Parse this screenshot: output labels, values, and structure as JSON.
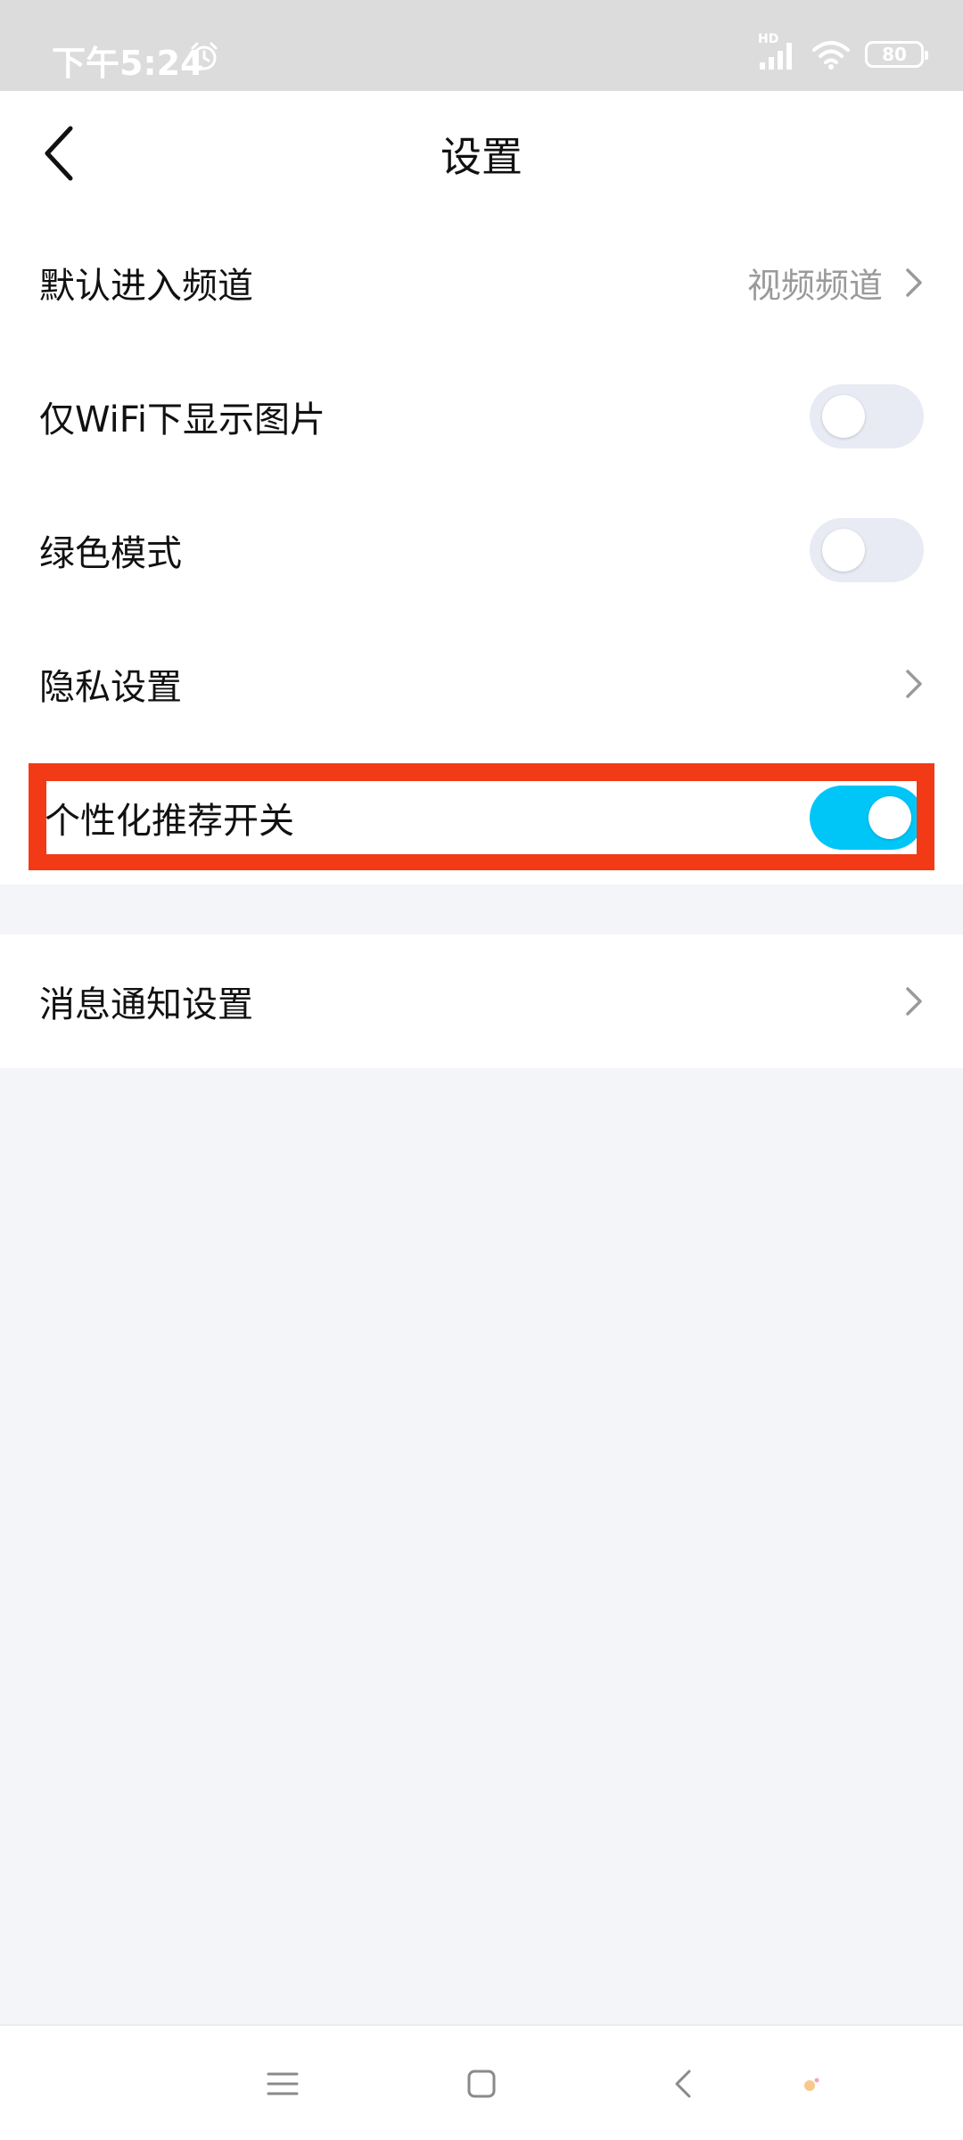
{
  "status_bar": {
    "time": "下午5:24",
    "network": "HD",
    "battery": "80"
  },
  "header": {
    "title": "设置",
    "back_icon": "chevron-left-icon"
  },
  "settings": {
    "default_channel": {
      "label": "默认进入频道",
      "value": "视频频道"
    },
    "wifi_images": {
      "label": "仅WiFi下显示图片",
      "enabled": false
    },
    "green_mode": {
      "label": "绿色模式",
      "enabled": false
    },
    "privacy": {
      "label": "隐私设置"
    },
    "personalized": {
      "label": "个性化推荐开关",
      "enabled": true
    },
    "notifications": {
      "label": "消息通知设置"
    }
  },
  "colors": {
    "toggle_on": "#00c6f8",
    "toggle_off": "#e8ebf3",
    "highlight": "#f23a16",
    "background": "#f4f5f9",
    "status_bar": "#dcdcdc"
  },
  "nav_bar": {
    "icons": [
      "menu-icon",
      "home-square-icon",
      "back-chevron-icon"
    ]
  }
}
